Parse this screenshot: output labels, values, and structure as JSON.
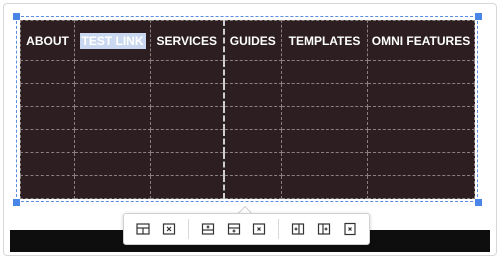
{
  "nav": {
    "items": [
      {
        "label": "ABOUT"
      },
      {
        "label": "TEST LINK"
      },
      {
        "label": "SERVICES"
      },
      {
        "label": "GUIDES"
      },
      {
        "label": "TEMPLATES"
      },
      {
        "label": "OMNI FEATURES"
      }
    ]
  },
  "colors": {
    "table_bg": "#2d1f21",
    "selection": "#4a86e8",
    "highlight": "#c9d8f0"
  },
  "toolbar": {
    "buttons": [
      {
        "icon": "table-properties-icon"
      },
      {
        "icon": "delete-table-icon"
      },
      {
        "icon": "insert-row-before-icon"
      },
      {
        "icon": "insert-row-after-icon"
      },
      {
        "icon": "delete-row-icon"
      },
      {
        "icon": "insert-column-before-icon"
      },
      {
        "icon": "insert-column-after-icon"
      },
      {
        "icon": "delete-column-icon"
      }
    ]
  }
}
